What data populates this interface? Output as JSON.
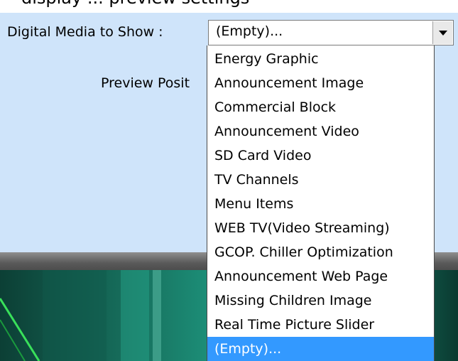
{
  "header_fragment": "display ... preview settings",
  "form": {
    "media_label": "Digital Media to Show :",
    "preview_label": "Preview Posit"
  },
  "combo": {
    "value": "(Empty)...",
    "arrow_icon": "chevron-down-icon"
  },
  "dropdown": {
    "selected_index": 12,
    "options": [
      "Energy Graphic",
      "Announcement Image",
      "Commercial Block",
      "Announcement Video",
      "SD Card Video",
      "TV Channels",
      "Menu Items",
      "WEB TV(Video Streaming)",
      "GCOP. Chiller Optimization",
      "Announcement Web Page",
      "Missing Children Image",
      "Real Time Picture Slider",
      "(Empty)..."
    ]
  },
  "colors": {
    "panel_bg": "#cfe4fa",
    "selection": "#3399ff"
  }
}
